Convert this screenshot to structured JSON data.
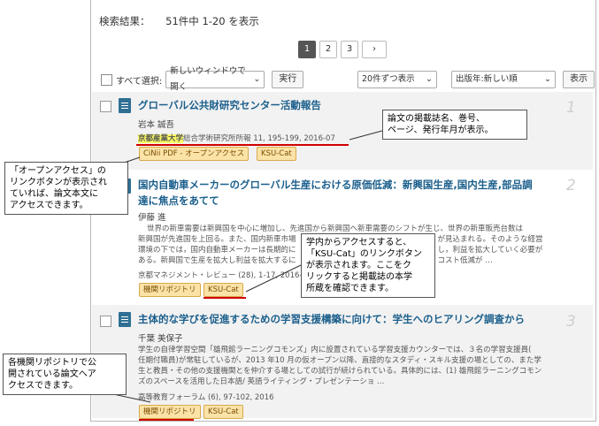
{
  "header": {
    "results_label": "検索結果：",
    "results_count": "51件中 1-20 を表示"
  },
  "pager": {
    "pages": [
      "1",
      "2",
      "3"
    ],
    "next": "›",
    "active": "1"
  },
  "controls": {
    "select_all": "すべて選択:",
    "open_mode": "新しいウィンドウで開く",
    "run": "実行",
    "per_page": "20件ずつ表示",
    "sort": "出版年:新しい順",
    "show": "表示"
  },
  "items": [
    {
      "number": "1",
      "title": "グローバル公共財研究センター活動報告",
      "author": "岩本 誠吾",
      "source_prefix": "京都産業大学",
      "source_rest": "総合学術研究所所報 11, 195-199, 2016-07",
      "tags": [
        "CiNii PDF - オープンアクセス",
        "KSU-Cat"
      ]
    },
    {
      "number": "2",
      "title_line1": "国内自動車メーカーのグローバル生産における原価低減：新興国生産,国内生産,部品調",
      "title_line2": "達に焦点をあてて",
      "author": "伊藤 進",
      "abstract_line1": "世界の新車需要は新興国を中心に増加し、先進国から新興国へ新車需要のシフトが生じ、世界の新車販売台数は",
      "abstract_line2": "新興国が先進国を上回る。また、国内新車市場",
      "abstract_line2b": "が見込まれる。そのような経営",
      "abstract_line3": "環境の下では，国内自動車メーカーは長期的に",
      "abstract_line3b": "し，利益を拡大していく必要が",
      "abstract_line4": "ある。新興国で生産を拡大し利益を拡大するに",
      "abstract_line4b": "コスト低減が …",
      "source": "京都マネジメント・レビュー (28), 1-17, 2016-03",
      "tags": [
        "機関リポジトリ",
        "KSU-Cat"
      ]
    },
    {
      "number": "3",
      "title": "主体的な学びを促進するための学習支援構築に向けて：学生へのヒアリング調査から",
      "author": "千葉 美保子",
      "abstract_line1": "学生の自律学習空間「雄飛館ラーニングコモンズ」内に設置されている学習支援カウンターでは、３名の学習支援員(",
      "abstract_line2": "任期付職員)が常駐しているが、2013 年10 月の仮オープン以降、直接的なスタディ・スキル支援の場としての、また学",
      "abstract_line3": "生と教員・その他の支援機関とを仲介する場としての試行が続けられている。具体的には、(1) 雄飛館ラーニングコモン",
      "abstract_line4": "ズのスペースを活用した日本語/ 英語ライティング・プレゼンテーショ …",
      "source": "高等教育フォーラム (6), 97-102, 2016",
      "tags": [
        "機関リポジトリ",
        "KSU-Cat"
      ]
    }
  ],
  "callouts": {
    "journal": [
      "論文の掲載誌名、巻号、",
      "ページ、発行年月が表示。"
    ],
    "open_access": [
      "「オープンアクセス」の",
      "リンクボタンが表示され",
      "ていれば、論文本文に",
      "アクセスできます。"
    ],
    "ksu_cat": [
      "学内からアクセスすると、",
      "「KSU-Cat」のリンクボタン",
      "が表示されます。ここをク",
      "リックすると掲載誌の本学",
      "所蔵を確認できます。"
    ],
    "repository": [
      "各機関リポジトリで公",
      "開されている論文へア",
      "クセスできます。"
    ]
  },
  "colors": {
    "link": "#1b5f8c",
    "tag_bg": "#fbe3a8",
    "underline": "#d00000",
    "highlight": "#ffff66"
  }
}
